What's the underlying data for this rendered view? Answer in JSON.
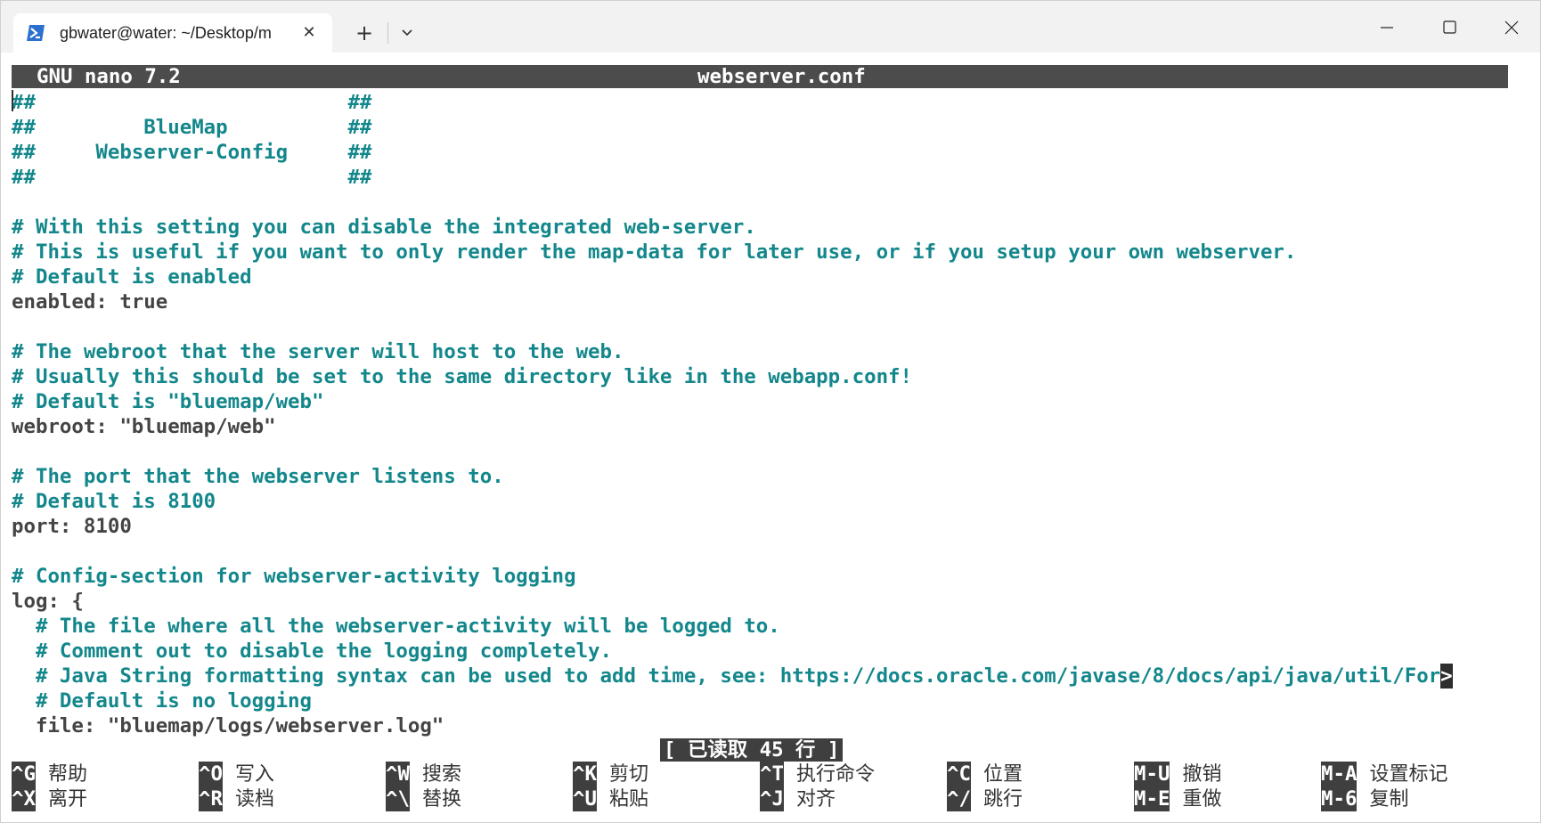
{
  "window": {
    "tab_title": "gbwater@water: ~/Desktop/m",
    "tab_icon": "powershell-icon",
    "new_tab_glyph": "+",
    "close_glyph": "✕"
  },
  "nano": {
    "version": "GNU nano 7.2",
    "filename": "webserver.conf",
    "status_message": "[ 已读取 45 行 ]",
    "lines": [
      {
        "kind": "comment",
        "text": "##                          ##"
      },
      {
        "kind": "comment",
        "text": "##         BlueMap          ##"
      },
      {
        "kind": "comment",
        "text": "##     Webserver-Config     ##"
      },
      {
        "kind": "comment",
        "text": "##                          ##"
      },
      {
        "kind": "plain",
        "text": ""
      },
      {
        "kind": "comment",
        "text": "# With this setting you can disable the integrated web-server."
      },
      {
        "kind": "comment",
        "text": "# This is useful if you want to only render the map-data for later use, or if you setup your own webserver."
      },
      {
        "kind": "comment",
        "text": "# Default is enabled"
      },
      {
        "kind": "plain",
        "text": "enabled: true"
      },
      {
        "kind": "plain",
        "text": ""
      },
      {
        "kind": "comment",
        "text": "# The webroot that the server will host to the web."
      },
      {
        "kind": "comment",
        "text": "# Usually this should be set to the same directory like in the webapp.conf!"
      },
      {
        "kind": "comment",
        "text": "# Default is \"bluemap/web\""
      },
      {
        "kind": "plain",
        "text": "webroot: \"bluemap/web\""
      },
      {
        "kind": "plain",
        "text": ""
      },
      {
        "kind": "comment",
        "text": "# The port that the webserver listens to."
      },
      {
        "kind": "comment",
        "text": "# Default is 8100"
      },
      {
        "kind": "plain",
        "text": "port: 8100"
      },
      {
        "kind": "plain",
        "text": ""
      },
      {
        "kind": "comment",
        "text": "# Config-section for webserver-activity logging"
      },
      {
        "kind": "plain",
        "text": "log: {"
      },
      {
        "kind": "comment",
        "text": "  # The file where all the webserver-activity will be logged to."
      },
      {
        "kind": "comment",
        "text": "  # Comment out to disable the logging completely."
      },
      {
        "kind": "comment",
        "text": "  # Java String formatting syntax can be used to add time, see: https://docs.oracle.com/javase/8/docs/api/java/util/For",
        "overflow": ">"
      },
      {
        "kind": "comment",
        "text": "  # Default is no logging"
      },
      {
        "kind": "plain",
        "text": "  file: \"bluemap/logs/webserver.log\""
      }
    ],
    "shortcuts": [
      {
        "key": "^G",
        "label": "帮助"
      },
      {
        "key": "^X",
        "label": "离开"
      },
      {
        "key": "^O",
        "label": "写入"
      },
      {
        "key": "^R",
        "label": "读档"
      },
      {
        "key": "^W",
        "label": "搜索"
      },
      {
        "key": "^\\",
        "label": "替换"
      },
      {
        "key": "^K",
        "label": "剪切"
      },
      {
        "key": "^U",
        "label": "粘贴"
      },
      {
        "key": "^T",
        "label": "执行命令"
      },
      {
        "key": "^J",
        "label": "对齐"
      },
      {
        "key": "^C",
        "label": "位置"
      },
      {
        "key": "^/",
        "label": "跳行"
      },
      {
        "key": "M-U",
        "label": "撤销"
      },
      {
        "key": "M-E",
        "label": "重做"
      },
      {
        "key": "M-A",
        "label": "设置标记"
      },
      {
        "key": "M-6",
        "label": "复制"
      }
    ]
  },
  "colors": {
    "comment": "#13878b",
    "plain": "#444444",
    "header_bg": "#4c4c4c"
  }
}
